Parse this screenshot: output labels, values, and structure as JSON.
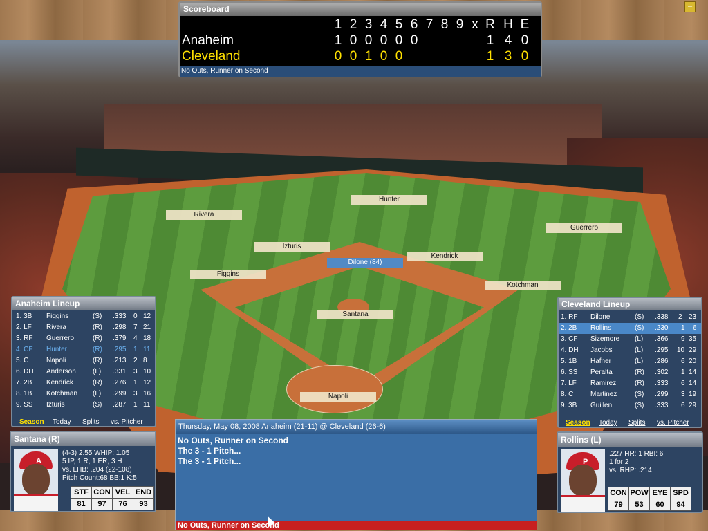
{
  "scoreboard": {
    "title": "Scoreboard",
    "innings": [
      "1",
      "2",
      "3",
      "4",
      "5",
      "6",
      "7",
      "8",
      "9"
    ],
    "headers": {
      "x": "x",
      "r": "R",
      "h": "H",
      "e": "E"
    },
    "teams": [
      {
        "name": "Anaheim",
        "innings": [
          "1",
          "0",
          "0",
          "0",
          "0",
          "0",
          "",
          "",
          ""
        ],
        "r": "1",
        "h": "4",
        "e": "0"
      },
      {
        "name": "Cleveland",
        "innings": [
          "0",
          "0",
          "1",
          "0",
          "0",
          "",
          "",
          "",
          ""
        ],
        "r": "1",
        "h": "3",
        "e": "0"
      }
    ],
    "status": "No Outs, Runner on Second",
    "minimize_label": "–"
  },
  "fielders": [
    {
      "name": "Hunter",
      "highlight": false
    },
    {
      "name": "Rivera",
      "highlight": false
    },
    {
      "name": "Guerrero",
      "highlight": false
    },
    {
      "name": "Izturis",
      "highlight": false
    },
    {
      "name": "Dilone (84)",
      "highlight": true
    },
    {
      "name": "Kendrick",
      "highlight": false
    },
    {
      "name": "Figgins",
      "highlight": false
    },
    {
      "name": "Kotchman",
      "highlight": false
    },
    {
      "name": "Santana",
      "highlight": false
    },
    {
      "name": "Napoli",
      "highlight": false
    }
  ],
  "away_lineup": {
    "title": "Anaheim Lineup",
    "rows": [
      {
        "pos": "1. 3B",
        "name": "Figgins",
        "hand": "(S)",
        "avg": ".333",
        "hr": "0",
        "rbi": "12"
      },
      {
        "pos": "2. LF",
        "name": "Rivera",
        "hand": "(R)",
        "avg": ".298",
        "hr": "7",
        "rbi": "21"
      },
      {
        "pos": "3. RF",
        "name": "Guerrero",
        "hand": "(R)",
        "avg": ".379",
        "hr": "4",
        "rbi": "18"
      },
      {
        "pos": "4. CF",
        "name": "Hunter",
        "hand": "(R)",
        "avg": ".295",
        "hr": "1",
        "rbi": "11"
      },
      {
        "pos": "5. C",
        "name": "Napoli",
        "hand": "(R)",
        "avg": ".213",
        "hr": "2",
        "rbi": "8"
      },
      {
        "pos": "6. DH",
        "name": "Anderson",
        "hand": "(L)",
        "avg": ".331",
        "hr": "3",
        "rbi": "10"
      },
      {
        "pos": "7. 2B",
        "name": "Kendrick",
        "hand": "(R)",
        "avg": ".276",
        "hr": "1",
        "rbi": "12"
      },
      {
        "pos": "8. 1B",
        "name": "Kotchman",
        "hand": "(L)",
        "avg": ".299",
        "hr": "3",
        "rbi": "16"
      },
      {
        "pos": "9. SS",
        "name": "Izturis",
        "hand": "(S)",
        "avg": ".287",
        "hr": "1",
        "rbi": "11"
      }
    ],
    "tabs": [
      "Season",
      "Today",
      "Splits",
      "vs. Pitcher"
    ]
  },
  "home_lineup": {
    "title": "Cleveland Lineup",
    "rows": [
      {
        "pos": "1. RF",
        "name": "Dilone",
        "hand": "(S)",
        "avg": ".338",
        "hr": "2",
        "rbi": "23"
      },
      {
        "pos": "2. 2B",
        "name": "Rollins",
        "hand": "(S)",
        "avg": ".230",
        "hr": "1",
        "rbi": "6"
      },
      {
        "pos": "3. CF",
        "name": "Sizemore",
        "hand": "(L)",
        "avg": ".366",
        "hr": "9",
        "rbi": "35"
      },
      {
        "pos": "4. DH",
        "name": "Jacobs",
        "hand": "(L)",
        "avg": ".295",
        "hr": "10",
        "rbi": "29"
      },
      {
        "pos": "5. 1B",
        "name": "Hafner",
        "hand": "(L)",
        "avg": ".286",
        "hr": "6",
        "rbi": "20"
      },
      {
        "pos": "6. SS",
        "name": "Peralta",
        "hand": "(R)",
        "avg": ".302",
        "hr": "1",
        "rbi": "14"
      },
      {
        "pos": "7. LF",
        "name": "Ramirez",
        "hand": "(R)",
        "avg": ".333",
        "hr": "6",
        "rbi": "14"
      },
      {
        "pos": "8. C",
        "name": "Martinez",
        "hand": "(S)",
        "avg": ".299",
        "hr": "3",
        "rbi": "19"
      },
      {
        "pos": "9. 3B",
        "name": "Guillen",
        "hand": "(S)",
        "avg": ".333",
        "hr": "6",
        "rbi": "29"
      }
    ],
    "tabs": [
      "Season",
      "Today",
      "Splits",
      "vs. Pitcher"
    ]
  },
  "pitcher": {
    "title": "Santana (R)",
    "line1": "(4-3) 2.55 WHIP: 1.05",
    "line2": "5 IP, 1 R, 1 ER, 3 H",
    "line3": "vs. LHB: .204 (22-108)",
    "line4": "Pitch Count:68 BB:1 K:5",
    "ratings_labels": [
      "STF",
      "CON",
      "VEL",
      "END"
    ],
    "ratings_values": [
      "81",
      "97",
      "76",
      "93"
    ],
    "cap_letter": "A",
    "cap_color": "#c81e2a"
  },
  "batter": {
    "title": "Rollins (L)",
    "line1": ".227 HR: 1 RBI: 6",
    "line2": "1 for 2",
    "line3": "vs. RHP: .214",
    "ratings_labels": [
      "CON",
      "POW",
      "EYE",
      "SPD"
    ],
    "ratings_values": [
      "79",
      "53",
      "60",
      "94"
    ],
    "cap_letter": "P",
    "cap_color": "#c81e2a"
  },
  "pbp": {
    "title": "Thursday, May 08, 2008 Anaheim (21-11) @ Cleveland (26-6)",
    "lines": [
      "No Outs, Runner on Second",
      "The 3 - 1 Pitch...",
      "The 3 - 1 Pitch..."
    ],
    "status": "No Outs, Runner on Second"
  }
}
